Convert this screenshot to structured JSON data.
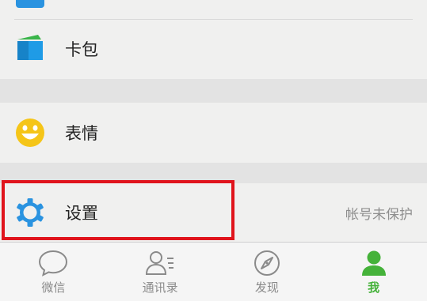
{
  "colors": {
    "accent": "#45b23a",
    "highlight_border": "#e0141c",
    "settings_icon": "#2a93e0",
    "card_icon": "#1f9be6",
    "sticker_icon": "#f5c518"
  },
  "menu": {
    "card_label": "卡包",
    "sticker_label": "表情",
    "settings_label": "设置",
    "settings_status": "帐号未保护"
  },
  "icons": {
    "card": "card-wallet-icon",
    "sticker": "smiley-face-icon",
    "settings": "gear-icon"
  },
  "tabbar": {
    "tabs": [
      {
        "label": "微信",
        "icon": "chat-bubble-icon",
        "active": false
      },
      {
        "label": "通讯录",
        "icon": "contacts-icon",
        "active": false
      },
      {
        "label": "发现",
        "icon": "compass-icon",
        "active": false
      },
      {
        "label": "我",
        "icon": "person-icon",
        "active": true
      }
    ]
  }
}
